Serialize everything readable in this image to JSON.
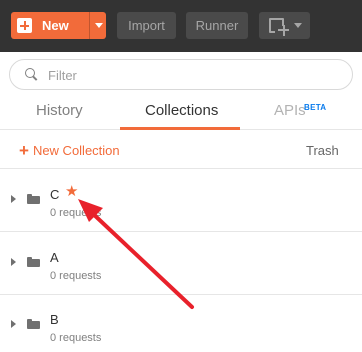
{
  "toolbar": {
    "new_label": "New",
    "import_label": "Import",
    "runner_label": "Runner",
    "icons": [
      "plus-icon",
      "chevron-down-icon",
      "new-window-icon"
    ]
  },
  "search": {
    "placeholder": "Filter",
    "value": ""
  },
  "tabs": [
    {
      "label": "History",
      "active": false
    },
    {
      "label": "Collections",
      "active": true
    },
    {
      "label": "APIs",
      "badge": "BETA",
      "active": false
    }
  ],
  "actions": {
    "new_collection_label": "New Collection",
    "trash_label": "Trash"
  },
  "collections": [
    {
      "name": "C",
      "requests": "0 requests",
      "starred": true
    },
    {
      "name": "A",
      "requests": "0 requests",
      "starred": false
    },
    {
      "name": "B",
      "requests": "0 requests",
      "starred": false
    }
  ],
  "colors": {
    "accent": "#f26b3a",
    "toolbar_bg": "#333333",
    "beta_badge": "#097bed",
    "annotation_arrow": "#e8212b"
  }
}
